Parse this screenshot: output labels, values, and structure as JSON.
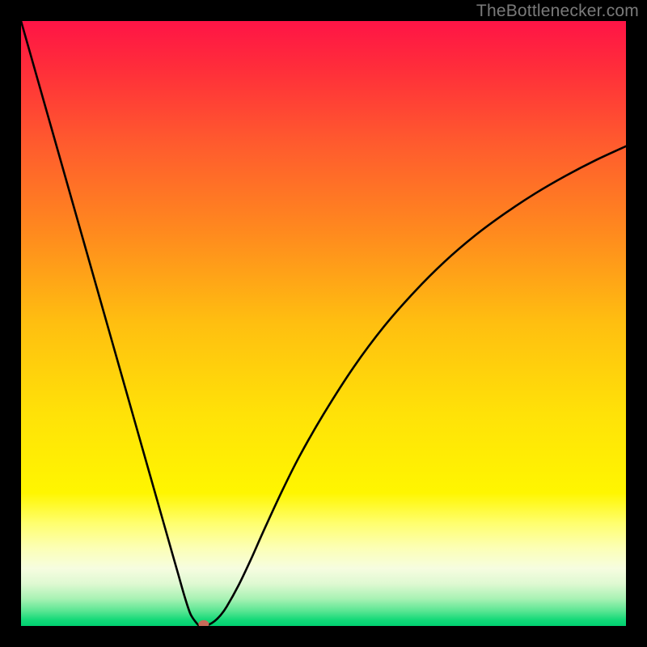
{
  "attribution": "TheBottlenecker.com",
  "chart_data": {
    "type": "line",
    "title": "",
    "xlabel": "",
    "ylabel": "",
    "xlim": [
      0,
      100
    ],
    "ylim": [
      0,
      100
    ],
    "gradient_stops": [
      {
        "offset": 0.0,
        "color": "#ff1446"
      },
      {
        "offset": 0.08,
        "color": "#ff2e3a"
      },
      {
        "offset": 0.2,
        "color": "#ff5a2e"
      },
      {
        "offset": 0.35,
        "color": "#ff8a1e"
      },
      {
        "offset": 0.5,
        "color": "#ffbf10"
      },
      {
        "offset": 0.65,
        "color": "#ffe208"
      },
      {
        "offset": 0.78,
        "color": "#fff600"
      },
      {
        "offset": 0.83,
        "color": "#ffff6e"
      },
      {
        "offset": 0.87,
        "color": "#fcffb4"
      },
      {
        "offset": 0.905,
        "color": "#f6fde0"
      },
      {
        "offset": 0.93,
        "color": "#dff9d2"
      },
      {
        "offset": 0.955,
        "color": "#a8f2b4"
      },
      {
        "offset": 0.975,
        "color": "#5be693"
      },
      {
        "offset": 0.99,
        "color": "#13d978"
      },
      {
        "offset": 1.0,
        "color": "#00d070"
      }
    ],
    "x": [
      0,
      2.5,
      5,
      7.5,
      10,
      12.5,
      15,
      17.5,
      20,
      22.5,
      25,
      26,
      27,
      28,
      29,
      29.5,
      30,
      31,
      32,
      33,
      34,
      36,
      38,
      40,
      43,
      46,
      50,
      55,
      60,
      65,
      70,
      75,
      80,
      85,
      90,
      95,
      100
    ],
    "y": [
      100,
      91.2,
      82.4,
      73.6,
      64.8,
      56.0,
      47.2,
      38.4,
      29.6,
      20.8,
      12.0,
      8.5,
      5.0,
      2.0,
      0.5,
      0.0,
      0.0,
      0.2,
      0.8,
      1.8,
      3.2,
      6.8,
      11.0,
      15.5,
      22.0,
      28.0,
      35.0,
      42.8,
      49.5,
      55.2,
      60.2,
      64.5,
      68.2,
      71.5,
      74.4,
      77.0,
      79.3
    ],
    "marker": {
      "x": 30.2,
      "y": 0.3,
      "color": "#c86a59"
    }
  }
}
